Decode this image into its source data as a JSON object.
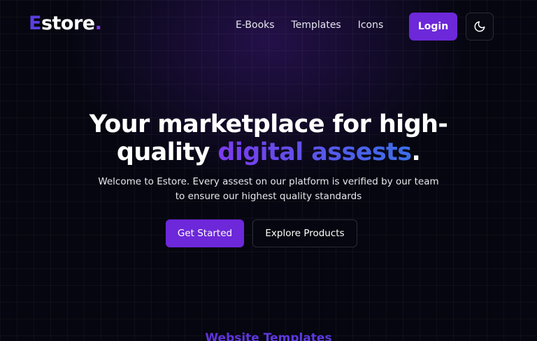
{
  "brand": {
    "initial": "E",
    "rest": "store",
    "dot": "."
  },
  "nav": {
    "items": [
      {
        "label": "E-Books"
      },
      {
        "label": "Templates"
      },
      {
        "label": "Icons"
      }
    ],
    "login_label": "Login",
    "theme_toggle_icon": "moon-icon"
  },
  "hero": {
    "title_line1": "Your marketplace for high-",
    "title_line2_plain": "quality ",
    "title_line2_highlight": "digital assests",
    "title_line2_end": ".",
    "subtitle": "Welcome to Estore. Every assest on our platform is verified by our team to ensure our highest quality standards",
    "primary_button": "Get Started",
    "secondary_button": "Explore Products"
  },
  "section": {
    "heading": "Website Templates"
  },
  "colors": {
    "background": "#05060f",
    "accent": "#6d28d9",
    "gradient_start": "#7c3aed",
    "gradient_end": "#3b6fe8"
  }
}
